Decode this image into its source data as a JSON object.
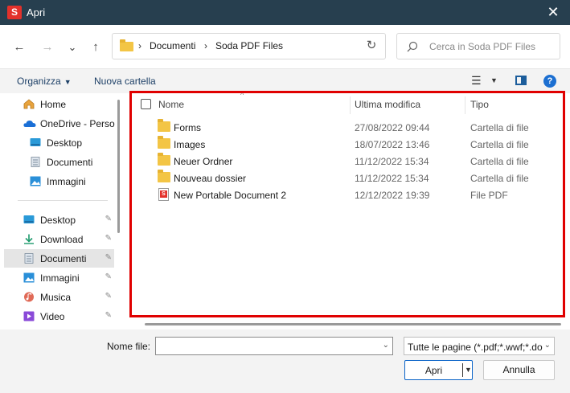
{
  "window": {
    "title": "Apri",
    "app_icon_letter": "S",
    "close_label": "✕"
  },
  "nav": {
    "back_icon": "←",
    "forward_icon": "→",
    "recent_icon": "⌄",
    "up_icon": "↑",
    "breadcrumb": [
      "Documenti",
      "Soda PDF Files"
    ],
    "separator": "›",
    "refresh_icon": "↻",
    "search_placeholder": "Cerca in Soda PDF Files"
  },
  "toolbar": {
    "organize_label": "Organizza",
    "new_folder_label": "Nuova cartella",
    "view_icon": "☰",
    "help_label": "?"
  },
  "sidebar": {
    "items": [
      {
        "label": "Home",
        "icon": "home-icon",
        "pinned": false
      },
      {
        "label": "OneDrive - Persor",
        "icon": "onedrive-icon",
        "pinned": false
      },
      {
        "label": "Desktop",
        "icon": "desktop-icon",
        "pinned": false
      },
      {
        "label": "Documenti",
        "icon": "documents-icon",
        "pinned": false
      },
      {
        "label": "Immagini",
        "icon": "pictures-icon",
        "pinned": false
      },
      {
        "label": "Desktop",
        "icon": "desktop-icon",
        "pinned": true
      },
      {
        "label": "Download",
        "icon": "download-icon",
        "pinned": true
      },
      {
        "label": "Documenti",
        "icon": "documents-icon",
        "pinned": true,
        "selected": true
      },
      {
        "label": "Immagini",
        "icon": "pictures-icon",
        "pinned": true
      },
      {
        "label": "Musica",
        "icon": "music-icon",
        "pinned": true
      },
      {
        "label": "Video",
        "icon": "video-icon",
        "pinned": true
      }
    ],
    "pin_glyph": "📌"
  },
  "filelist": {
    "columns": {
      "name": "Nome",
      "modified": "Ultima modifica",
      "type": "Tipo"
    },
    "sort_glyph": "^",
    "rows": [
      {
        "name": "Forms",
        "modified": "27/08/2022 09:44",
        "type": "Cartella di file",
        "kind": "folder"
      },
      {
        "name": "Images",
        "modified": "18/07/2022 13:46",
        "type": "Cartella di file",
        "kind": "folder"
      },
      {
        "name": "Neuer Ordner",
        "modified": "11/12/2022 15:34",
        "type": "Cartella di file",
        "kind": "folder"
      },
      {
        "name": "Nouveau dossier",
        "modified": "11/12/2022 15:34",
        "type": "Cartella di file",
        "kind": "folder"
      },
      {
        "name": "New Portable Document 2",
        "modified": "12/12/2022 19:39",
        "type": "File PDF",
        "kind": "pdf"
      }
    ]
  },
  "footer": {
    "filename_label": "Nome file:",
    "filename_value": "",
    "filter_value": "Tutte le pagine (*.pdf;*.wwf;*.doc",
    "open_label": "Apri",
    "cancel_label": "Annulla",
    "dropdown_glyph": "⌄"
  },
  "colors": {
    "titlebar": "#273f4f",
    "highlight_frame": "#e00000",
    "accent": "#0a64c8"
  }
}
